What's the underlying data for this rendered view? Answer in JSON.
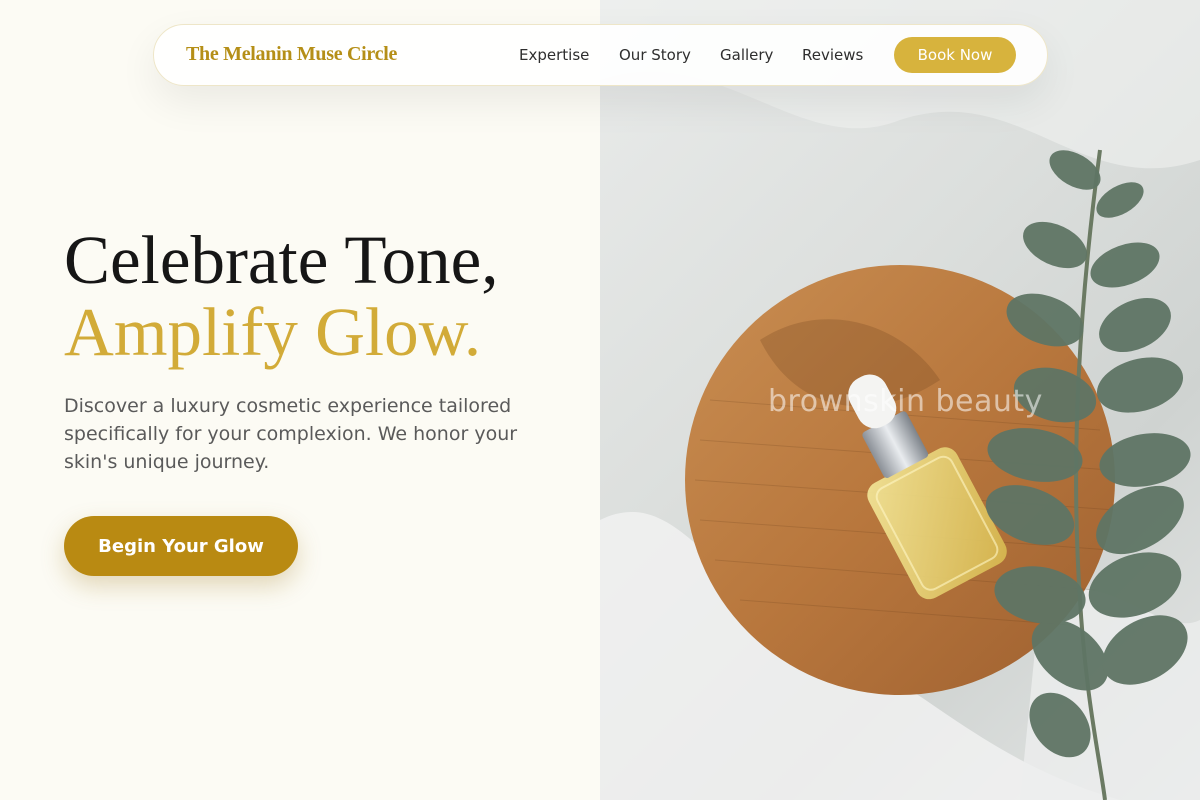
{
  "nav": {
    "brand": "The Melanin Muse Circle",
    "links": [
      "Expertise",
      "Our Story",
      "Gallery",
      "Reviews"
    ],
    "cta": "Book Now"
  },
  "hero": {
    "headline_line1": "Celebrate Tone,",
    "headline_line2": "Amplify Glow.",
    "subtitle": "Discover a luxury cosmetic experience tailored specifically for your complexion. We honor your skin's unique journey.",
    "cta": "Begin Your Glow",
    "image_watermark": "brownskin beauty"
  },
  "colors": {
    "background": "#fcfbf4",
    "gold_accent": "#d2ab38",
    "brand_gold": "#b58f17",
    "cta_gold": "#b98a12",
    "button_gold": "#d7b33d",
    "text_dark": "#161616",
    "text_muted": "#5a5a5a"
  }
}
